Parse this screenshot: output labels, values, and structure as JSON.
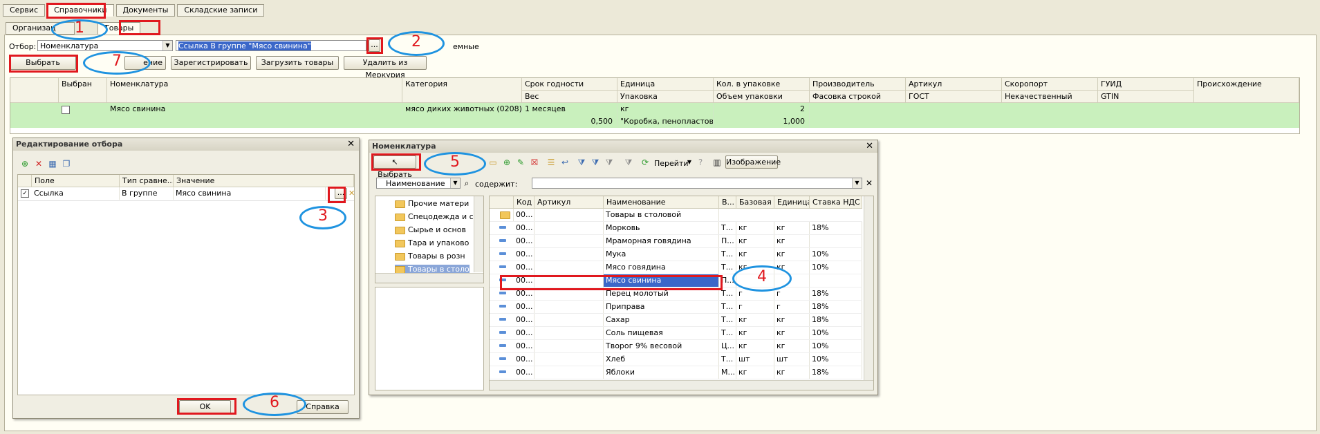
{
  "tabs_top": [
    "Сервис",
    "Справочники",
    "Документы",
    "Складские записи"
  ],
  "tabs_second": [
    "Организац",
    "Товары"
  ],
  "filter": {
    "label": "Отбор:",
    "field": "Номенклатура",
    "value": "Ссылка В группе \"Мясо свинина\"",
    "ellipsis": "...",
    "checkbox_text": "емные"
  },
  "toolbar": {
    "select": "Выбрать",
    "partial": "ение",
    "register": "Зарегистрировать",
    "load": "Загрузить товары",
    "delete": "Удалить из Меркурия"
  },
  "main_table": {
    "headers_row1": [
      "Выбран",
      "Номенклатура",
      "Категория",
      "Срок годности",
      "Единица",
      "Кол. в упаковке",
      "Производитель",
      "Артикул",
      "Скоропорт",
      "ГУИД",
      "Происхождение"
    ],
    "headers_row2": [
      "Вес",
      "Упаковка",
      "Объем упаковки",
      "Фасовка строкой",
      "ГОСТ",
      "Некачественный",
      "GTIN"
    ],
    "row": {
      "name": "Мясо свинина",
      "category": "мясо диких животных (0208)",
      "shelf": "1 месяцев",
      "unit": "кг",
      "pack_qty": "2",
      "weight": "0,500",
      "package": "\"Коробка, пенопластов...",
      "pack_volume": "1,000"
    }
  },
  "filter_dialog": {
    "title": "Редактирование отбора",
    "headers": [
      "Поле",
      "Тип сравне...",
      "Значение"
    ],
    "row": {
      "field": "Ссылка",
      "type": "В группе",
      "value": "Мясо свинина"
    },
    "ellipsis": "...",
    "ok": "OK",
    "help": "Справка"
  },
  "nomen_dialog": {
    "title": "Номенклатура",
    "select": "Выбрать",
    "goto": "Перейти",
    "image": "Изображение",
    "search_field": "Наименование",
    "contains_label": "содержит:",
    "tree": [
      "Прочие матери",
      "Спецодежда и с",
      "Сырье и основ",
      "Тара и упаково",
      "Товары в розн",
      "Товары в столо"
    ],
    "headers": [
      "Код",
      "Артикул",
      "Наименование",
      "В...",
      "Базовая",
      "Единица",
      "Ставка НДС"
    ],
    "group_row": {
      "code": "00...",
      "name": "Товары в столовой"
    },
    "rows": [
      {
        "code": "00...",
        "name": "Морковь",
        "v": "Т...",
        "base": "кг",
        "unit": "кг",
        "vat": "18%"
      },
      {
        "code": "00...",
        "name": "Мраморная говядина",
        "v": "П...",
        "base": "кг",
        "unit": "кг",
        "vat": ""
      },
      {
        "code": "00...",
        "name": "Мука",
        "v": "Т...",
        "base": "кг",
        "unit": "кг",
        "vat": "10%"
      },
      {
        "code": "00...",
        "name": "Мясо говядина",
        "v": "Т...",
        "base": "кг",
        "unit": "кг",
        "vat": "10%"
      },
      {
        "code": "00...",
        "name": "Мясо свинина",
        "v": "П...",
        "base": "",
        "unit": "",
        "vat": ""
      },
      {
        "code": "00...",
        "name": "Перец молотый",
        "v": "Т...",
        "base": "г",
        "unit": "г",
        "vat": "18%"
      },
      {
        "code": "00...",
        "name": "Приправа",
        "v": "Т...",
        "base": "г",
        "unit": "г",
        "vat": "18%"
      },
      {
        "code": "00...",
        "name": "Сахар",
        "v": "Т...",
        "base": "кг",
        "unit": "кг",
        "vat": "18%"
      },
      {
        "code": "00...",
        "name": "Соль пищевая",
        "v": "Т...",
        "base": "кг",
        "unit": "кг",
        "vat": "10%"
      },
      {
        "code": "00...",
        "name": "Творог 9% весовой",
        "v": "Ц...",
        "base": "кг",
        "unit": "кг",
        "vat": "10%"
      },
      {
        "code": "00...",
        "name": "Хлеб",
        "v": "Т...",
        "base": "шт",
        "unit": "шт",
        "vat": "10%"
      },
      {
        "code": "00...",
        "name": "Яблоки",
        "v": "М...",
        "base": "кг",
        "unit": "кг",
        "vat": "18%"
      }
    ]
  },
  "annotations": [
    "1",
    "2",
    "3",
    "4",
    "5",
    "6",
    "7"
  ],
  "colors": {
    "accent_red": "#e0181e",
    "accent_blue": "#1f93e0",
    "row_green": "#c9f0bd",
    "selection": "#3b67c9"
  }
}
